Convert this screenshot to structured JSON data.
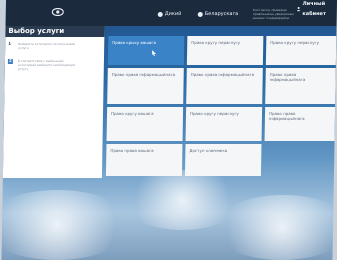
{
  "header": {
    "lang1_label": "Дикий",
    "lang2_label": "Беларускага",
    "info_text": "Калі ласка, праверце правільнасць уведзенных данных і падцвердзіце",
    "cabinet_label": "Личный кабинет"
  },
  "sidebar": {
    "title": "Выбор услуги",
    "steps": [
      {
        "num": "1",
        "text": "Выберите категорию по получению услуги"
      },
      {
        "num": "2",
        "text": "В соответствии с выбранной категорией выберите необходимую услугу"
      }
    ]
  },
  "tiles": [
    {
      "label": "Право крыху вашага"
    },
    {
      "label": "Право кругу пераслугу"
    },
    {
      "label": "Право кругу пераслугу"
    },
    {
      "label": "Право права інфармацыйнага"
    },
    {
      "label": "Право права інфармацыйнага"
    },
    {
      "label": "Право права інфармацыйнага"
    },
    {
      "label": "Право кругу вашага"
    },
    {
      "label": "Право кругу пераслугу"
    },
    {
      "label": "Право права інфармацыйнага"
    },
    {
      "label": "Право права вашага"
    },
    {
      "label": "Доступ ключевіка"
    }
  ],
  "colors": {
    "active_tile": "#3b83c7",
    "topbar": "#1b2a3d",
    "sidebar_header": "#2a3a50"
  },
  "icons": [
    "eye-icon",
    "user-icon",
    "pointer-icon"
  ]
}
